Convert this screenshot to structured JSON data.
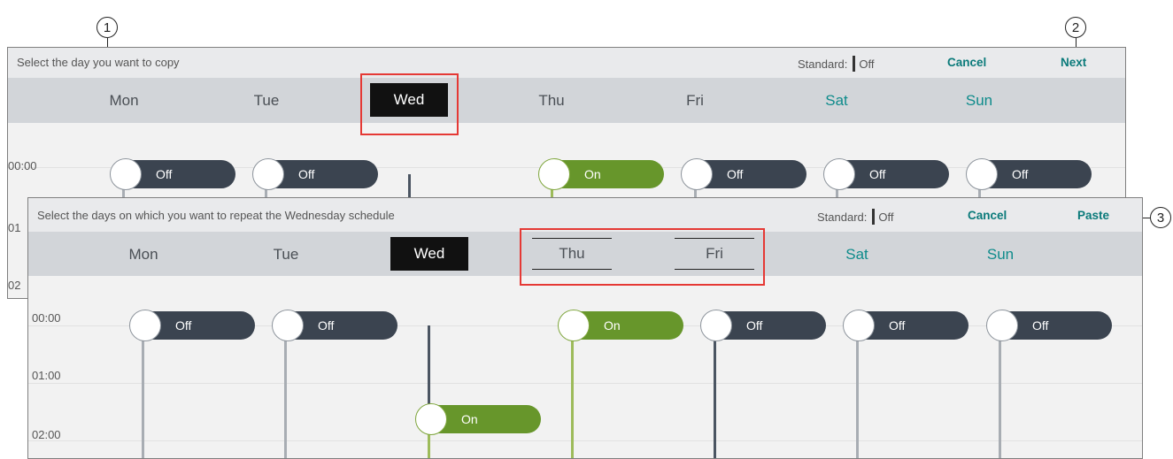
{
  "callouts": [
    "1",
    "2",
    "3"
  ],
  "days": [
    "Mon",
    "Tue",
    "Wed",
    "Thu",
    "Fri",
    "Sat",
    "Sun"
  ],
  "times": [
    "00:00",
    "01:00",
    "02:00"
  ],
  "times_truncated": [
    "00:00",
    "01",
    "02"
  ],
  "colors": {
    "off": "#3b4450",
    "on": "#67962b",
    "accent": "#0a7a7a",
    "highlight": "#e53935",
    "line_off": "#a8adb3",
    "line_on": "#9dbb5a",
    "line_dark": "#4b5562"
  },
  "copy_panel": {
    "instruction": "Select the day you want to copy",
    "standard_label": "Standard:",
    "standard_value": "Off",
    "cancel": "Cancel",
    "next": "Next",
    "selected_day": "Wed",
    "toggles": [
      {
        "day": "Mon",
        "state": "Off"
      },
      {
        "day": "Tue",
        "state": "Off"
      },
      {
        "day": "Thu",
        "state": "On"
      },
      {
        "day": "Fri",
        "state": "Off"
      },
      {
        "day": "Sat",
        "state": "Off"
      },
      {
        "day": "Sun",
        "state": "Off"
      }
    ]
  },
  "paste_panel": {
    "instruction": "Select the days on which you want to repeat the Wednesday schedule",
    "standard_label": "Standard:",
    "standard_value": "Off",
    "cancel": "Cancel",
    "paste": "Paste",
    "source_day": "Wed",
    "target_days": [
      "Thu",
      "Fri"
    ],
    "toggles": [
      {
        "day": "Mon",
        "time": "00:00",
        "state": "Off"
      },
      {
        "day": "Tue",
        "time": "00:00",
        "state": "Off"
      },
      {
        "day": "Wed",
        "time": "02:00",
        "state": "On"
      },
      {
        "day": "Thu",
        "time": "00:00",
        "state": "On"
      },
      {
        "day": "Fri",
        "time": "00:00",
        "state": "Off"
      },
      {
        "day": "Sat",
        "time": "00:00",
        "state": "Off"
      },
      {
        "day": "Sun",
        "time": "00:00",
        "state": "Off"
      }
    ]
  }
}
